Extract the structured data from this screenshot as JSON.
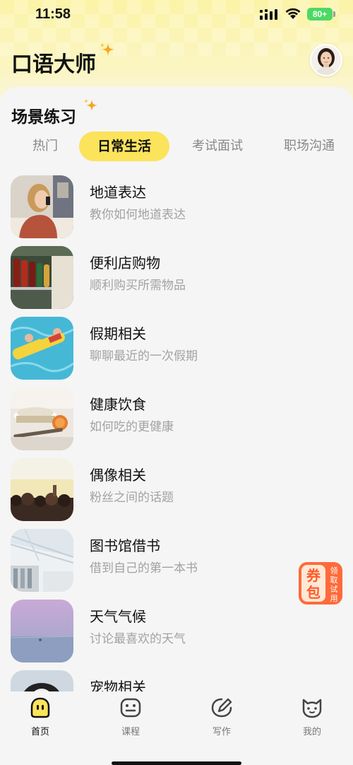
{
  "status_bar": {
    "time": "11:58",
    "battery": "80+"
  },
  "header": {
    "title": "口语大师"
  },
  "section": {
    "title": "场景练习"
  },
  "tabs": [
    {
      "label": "热门"
    },
    {
      "label": "日常生活",
      "active": true
    },
    {
      "label": "考试面试"
    },
    {
      "label": "职场沟通"
    }
  ],
  "scenes": [
    {
      "title": "地道表达",
      "subtitle": "教你如何地道表达",
      "thumb_icon": "woman-phone-photo"
    },
    {
      "title": "便利店购物",
      "subtitle": "顺利购买所需物品",
      "thumb_icon": "store-shelf-photo"
    },
    {
      "title": "假期相关",
      "subtitle": "聊聊最近的一次假期",
      "thumb_icon": "pool-float-photo"
    },
    {
      "title": "健康饮食",
      "subtitle": "如何吃的更健康",
      "thumb_icon": "healthy-food-photo"
    },
    {
      "title": "偶像相关",
      "subtitle": "粉丝之间的话题",
      "thumb_icon": "concert-crowd-photo"
    },
    {
      "title": "图书馆借书",
      "subtitle": "借到自己的第一本书",
      "thumb_icon": "library-photo"
    },
    {
      "title": "天气气候",
      "subtitle": "讨论最喜欢的天气",
      "thumb_icon": "weather-lake-photo"
    },
    {
      "title": "宠物相关",
      "subtitle": "",
      "thumb_icon": "pet-dog-photo"
    }
  ],
  "coupon": {
    "big1": "券",
    "big2": "包",
    "small": [
      "领",
      "取",
      "试",
      "用"
    ]
  },
  "tabbar": [
    {
      "label": "首页",
      "icon": "home-face-icon",
      "active": true
    },
    {
      "label": "课程",
      "icon": "course-face-icon"
    },
    {
      "label": "写作",
      "icon": "writing-icon"
    },
    {
      "label": "我的",
      "icon": "profile-cat-icon"
    }
  ],
  "colors": {
    "accent": "#fbe35c",
    "header_bg": "#fbf3a6",
    "coupon": "#ff6a3a"
  }
}
